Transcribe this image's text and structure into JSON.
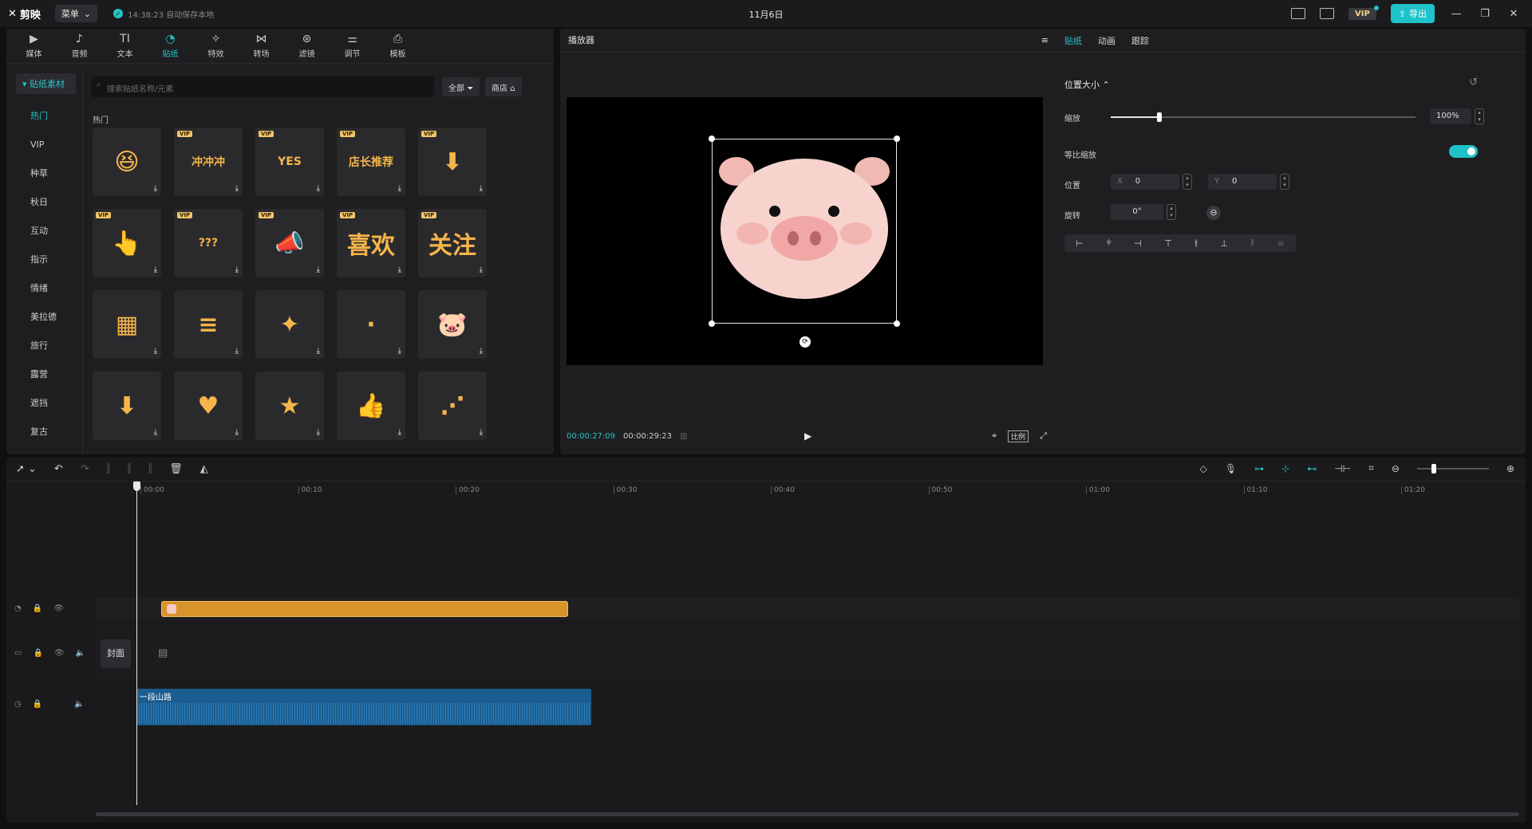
{
  "app": {
    "logo": "剪映",
    "menu_label": "菜单",
    "save_status": "14:38:23 自动保存本地",
    "title": "11月6日",
    "vip_label": "VIP",
    "export_label": "导出",
    "window_controls": [
      "minimize-icon",
      "restore-icon",
      "close-icon"
    ]
  },
  "tool_tabs": [
    {
      "label": "媒体",
      "icon": "media-icon",
      "glyph": "▶"
    },
    {
      "label": "音频",
      "icon": "audio-icon",
      "glyph": "♪"
    },
    {
      "label": "文本",
      "icon": "text-icon",
      "glyph": "TI"
    },
    {
      "label": "贴纸",
      "icon": "sticker-icon",
      "glyph": "◔",
      "active": true
    },
    {
      "label": "特效",
      "icon": "effects-icon",
      "glyph": "✧"
    },
    {
      "label": "转场",
      "icon": "transition-icon",
      "glyph": "⋈"
    },
    {
      "label": "滤镜",
      "icon": "filter-icon",
      "glyph": "⊛"
    },
    {
      "label": "调节",
      "icon": "adjust-icon",
      "glyph": "⚌"
    },
    {
      "label": "模板",
      "icon": "template-icon",
      "glyph": "⎙"
    }
  ],
  "sticker_panel": {
    "category_head": "贴纸素材",
    "categories": [
      "热门",
      "VIP",
      "种草",
      "秋日",
      "互动",
      "指示",
      "情绪",
      "美拉德",
      "旅行",
      "露营",
      "遮挡",
      "复古"
    ],
    "active_category": "热门",
    "search_placeholder": "搜索贴纸名称/元素",
    "filter_label": "全部",
    "shop_label": "商店",
    "section_label": "热门",
    "vip_tag": "VIP",
    "items": [
      {
        "vip": false,
        "glyph": "😆",
        "name": "laughing-face"
      },
      {
        "vip": true,
        "glyph": "冲冲冲",
        "name": "charge-text"
      },
      {
        "vip": true,
        "glyph": "YES",
        "name": "yes-text"
      },
      {
        "vip": true,
        "glyph": "店长推荐",
        "name": "recommend-text"
      },
      {
        "vip": true,
        "glyph": "⬇",
        "name": "red-arrow"
      },
      {
        "vip": true,
        "glyph": "👆",
        "name": "pointing-hand"
      },
      {
        "vip": true,
        "glyph": "???",
        "name": "question-marks"
      },
      {
        "vip": true,
        "glyph": "📣",
        "name": "megaphone"
      },
      {
        "vip": true,
        "glyph": "喜欢",
        "name": "like-text"
      },
      {
        "vip": true,
        "glyph": "关注",
        "name": "follow-text"
      },
      {
        "vip": false,
        "glyph": "▦",
        "name": "mosaic"
      },
      {
        "vip": false,
        "glyph": "≡",
        "name": "text-list"
      },
      {
        "vip": false,
        "glyph": "✦",
        "name": "sparkle"
      },
      {
        "vip": false,
        "glyph": "·",
        "name": "dust"
      },
      {
        "vip": false,
        "glyph": "🐷",
        "name": "pig-face"
      },
      {
        "vip": false,
        "glyph": "⬇",
        "name": "down-arrow"
      },
      {
        "vip": false,
        "glyph": "♥",
        "name": "heart"
      },
      {
        "vip": false,
        "glyph": "★",
        "name": "star"
      },
      {
        "vip": false,
        "glyph": "👍",
        "name": "thumbs-up"
      },
      {
        "vip": false,
        "glyph": "⋰",
        "name": "stars-dust"
      }
    ]
  },
  "player": {
    "title": "播放器",
    "time_current": "00:00:27:09",
    "time_total": "00:00:29:23",
    "ratio_label": "比例",
    "sticker_glyph": "🐷"
  },
  "inspector": {
    "tabs": [
      "贴纸",
      "动画",
      "跟踪"
    ],
    "active_tab": "贴纸",
    "section": "位置大小",
    "scale_label": "缩放",
    "scale_value": "100%",
    "scale_fraction": 0.16,
    "uniform_label": "等比缩放",
    "uniform_on": true,
    "position_label": "位置",
    "x_label": "X",
    "x_value": "0",
    "y_label": "Y",
    "y_value": "0",
    "rotate_label": "旋转",
    "rotate_value": "0°"
  },
  "timeline": {
    "ruler": [
      "00:00",
      "00:10",
      "00:20",
      "00:30",
      "00:40",
      "00:50",
      "01:00",
      "01:10",
      "01:20"
    ],
    "cover_label": "封面",
    "audio_clip_name": "一段山路"
  }
}
